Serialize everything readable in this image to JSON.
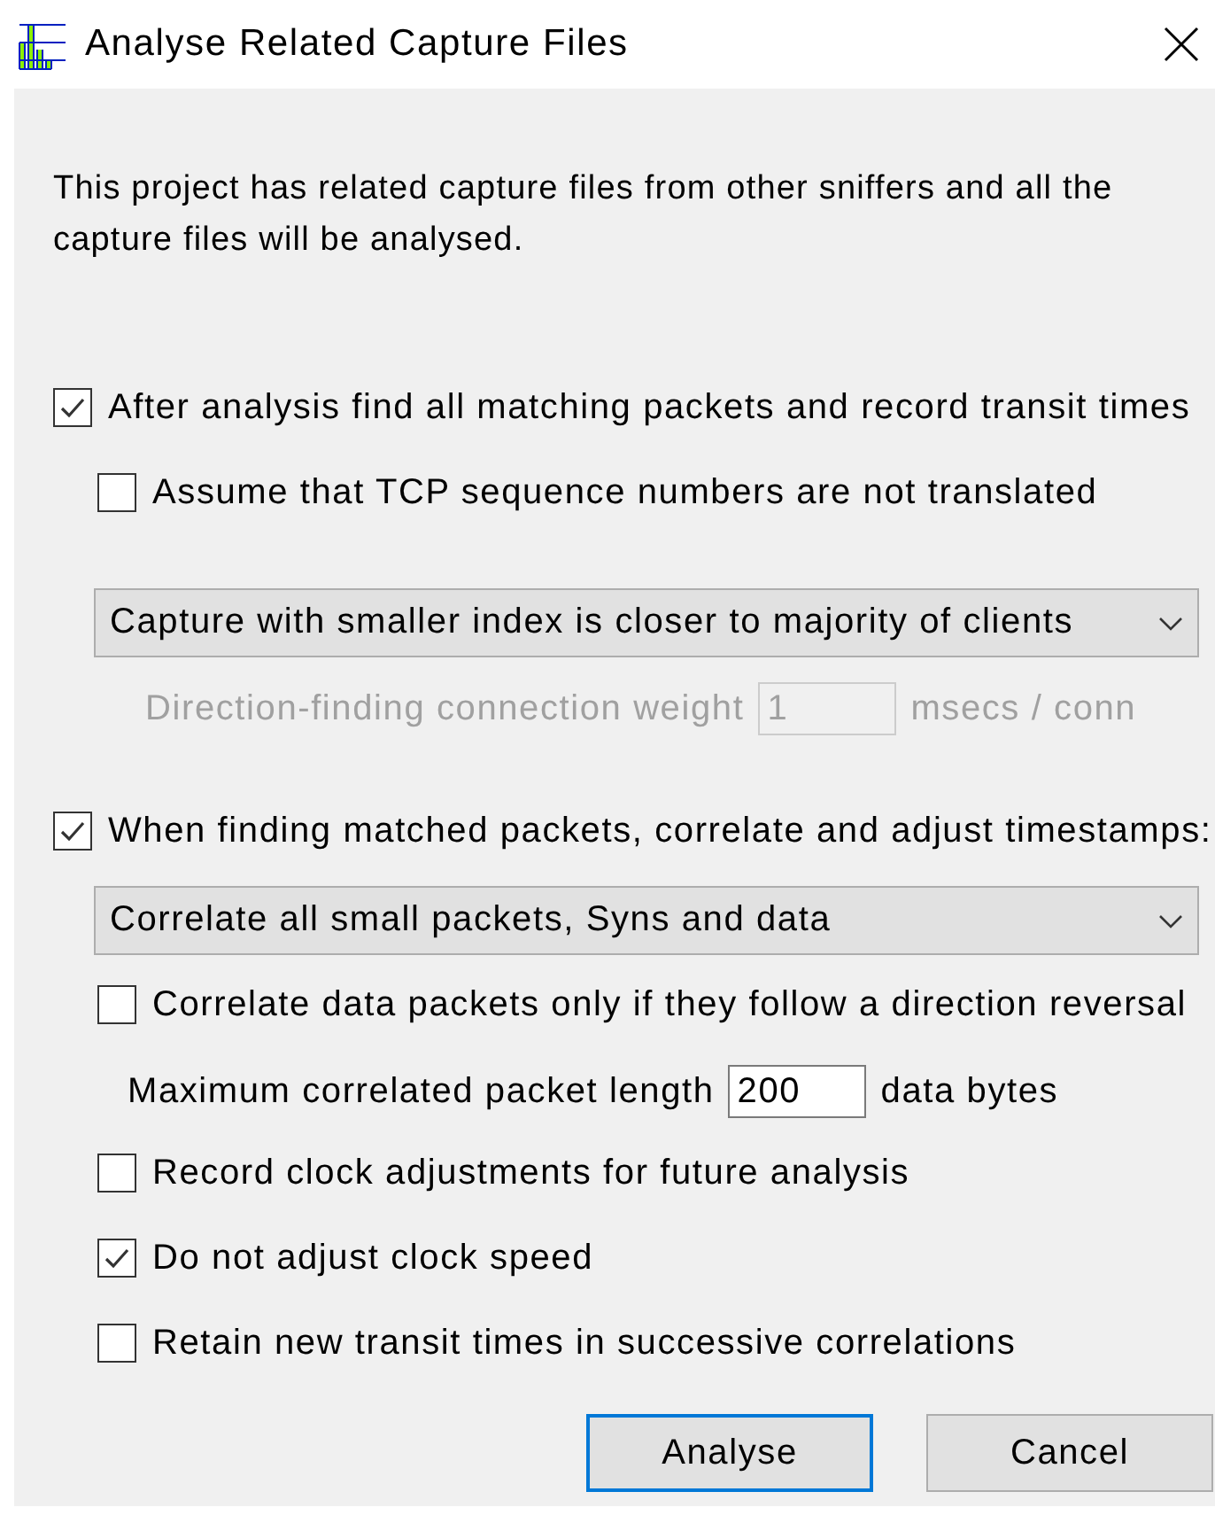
{
  "window": {
    "title": "Analyse Related Capture Files"
  },
  "intro": "This project has related capture files from other sniffers and all the capture files will be analysed.",
  "find_matching": {
    "label": "After analysis find all matching packets and record transit times",
    "checked": true
  },
  "assume_tcp": {
    "label": "Assume that TCP sequence numbers are not translated",
    "checked": false
  },
  "direction_dropdown": {
    "value": "Capture with smaller index is closer to majority of clients"
  },
  "direction_weight": {
    "label": "Direction-finding connection weight",
    "value": "1",
    "unit": "msecs / conn",
    "disabled": true
  },
  "correlate": {
    "label": "When finding matched packets, correlate and adjust timestamps:",
    "checked": true
  },
  "correlate_dropdown": {
    "value": "Correlate all small packets, Syns and data"
  },
  "correlate_reversal": {
    "label": "Correlate data packets only if they follow a direction reversal",
    "checked": false
  },
  "max_length": {
    "label": "Maximum correlated packet length",
    "value": "200",
    "unit": "data bytes",
    "disabled": false
  },
  "more_options": [
    {
      "label": "Record clock adjustments for future analysis",
      "checked": false
    },
    {
      "label": "Do not adjust clock speed",
      "checked": true
    },
    {
      "label": "Retain new transit times in successive correlations",
      "checked": false
    }
  ],
  "buttons": [
    {
      "label": "Analyse",
      "default": true
    },
    {
      "label": "Cancel",
      "default": false
    }
  ]
}
